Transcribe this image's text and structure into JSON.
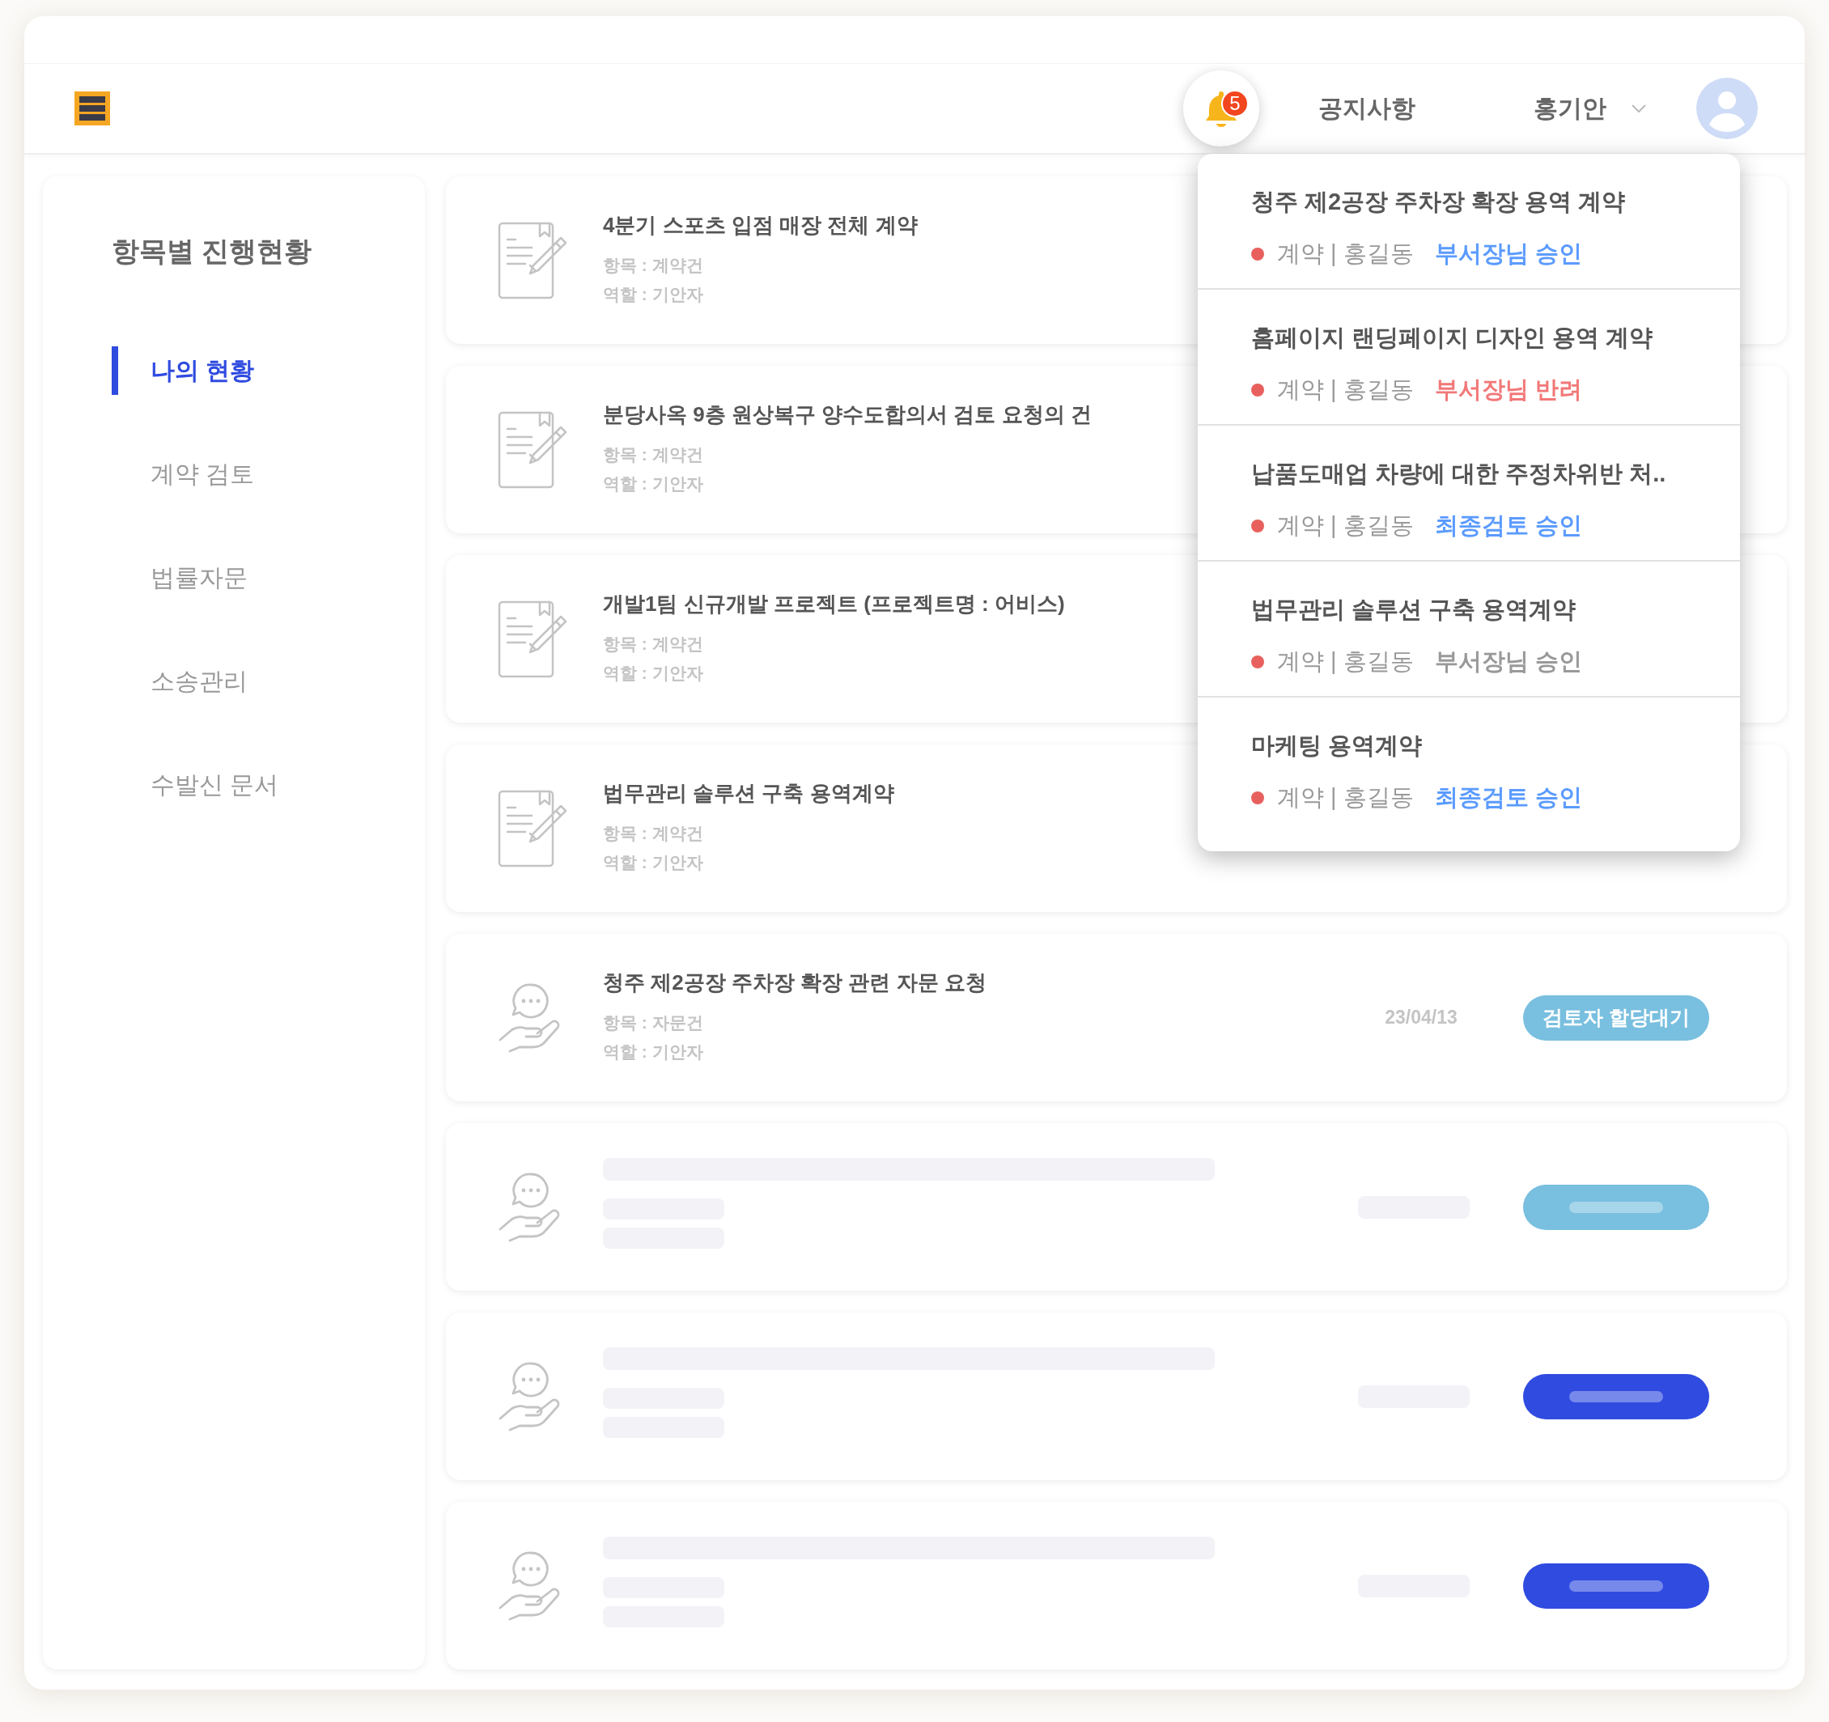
{
  "header": {
    "notification_count": "5",
    "notice_link": "공지사항",
    "user_name": "홍기안"
  },
  "sidebar": {
    "title": "항목별 진행현황",
    "items": [
      {
        "label": "나의 현황",
        "selected": true
      },
      {
        "label": "계약 검토",
        "selected": false
      },
      {
        "label": "법률자문",
        "selected": false
      },
      {
        "label": "소송관리",
        "selected": false
      },
      {
        "label": "수발신 문서",
        "selected": false
      }
    ]
  },
  "cards": [
    {
      "kind": "contract",
      "loading": false,
      "title": "4분기 스포츠 입점 매장 전체 계약",
      "category": "항목 : 계약건",
      "role": "역할 : 기안자"
    },
    {
      "kind": "contract",
      "loading": false,
      "title": "분당사옥 9층 원상복구 양수도합의서 검토 요청의 건",
      "category": "항목 : 계약건",
      "role": "역할 : 기안자"
    },
    {
      "kind": "contract",
      "loading": false,
      "title": "개발1팀 신규개발 프로젝트 (프로젝트명 : 어비스)",
      "category": "항목 : 계약건",
      "role": "역할 : 기안자"
    },
    {
      "kind": "contract",
      "loading": false,
      "title": "법무관리 솔루션 구축 용역계약",
      "category": "항목 : 계약건",
      "role": "역할 : 기안자"
    },
    {
      "kind": "advice",
      "loading": false,
      "title": "청주 제2공장 주차장 확장 관련 자문 요청",
      "category": "항목 : 자문건",
      "role": "역할 : 기안자",
      "date": "23/04/13",
      "status": "검토자 할당대기",
      "color": "#79bfdf"
    },
    {
      "kind": "advice",
      "loading": true,
      "color": "#79bfdf"
    },
    {
      "kind": "advice",
      "loading": true,
      "color": "#2f4be0"
    },
    {
      "kind": "advice",
      "loading": true,
      "color": "#2f4be0"
    }
  ],
  "notifications": [
    {
      "title": "청주 제2공장 주차장 확장 용역 계약",
      "meta": "계약 | 홍길동",
      "status": "부서장님 승인",
      "color": "#5b9bff"
    },
    {
      "title": "홈페이지 랜딩페이지 디자인 용역 계약",
      "meta": "계약 | 홍길동",
      "status": "부서장님 반려",
      "color": "#f27878"
    },
    {
      "title": "납품도매업 차량에 대한 주정차위반 처..",
      "meta": "계약 | 홍길동",
      "status": "최종검토 승인",
      "color": "#5b9bff"
    },
    {
      "title": "법무관리 솔루션 구축 용역계약",
      "meta": "계약 | 홍길동",
      "status": "부서장님 승인",
      "color": "#999999"
    },
    {
      "title": "마케팅 용역계약",
      "meta": "계약 | 홍길동",
      "status": "최종검토 승인",
      "color": "#5b9bff"
    }
  ]
}
